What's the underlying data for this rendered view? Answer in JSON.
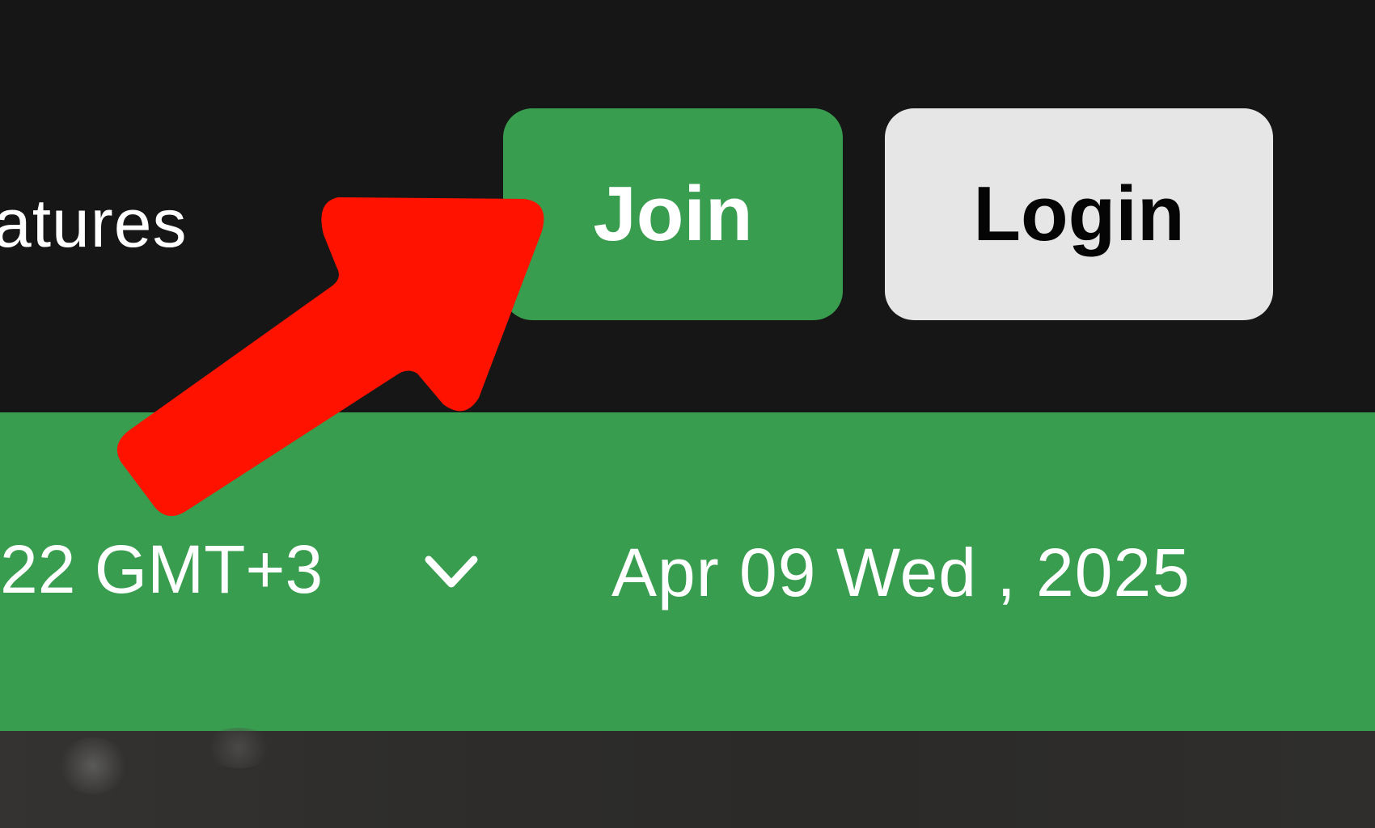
{
  "nav": {
    "features_label": "atures",
    "join_label": "Join",
    "login_label": "Login"
  },
  "info_bar": {
    "timezone_text": "22 GMT+3",
    "date_text": "Apr 09 Wed , 2025"
  },
  "colors": {
    "background": "#161616",
    "accent_green": "#389d4e",
    "login_bg": "#e6e6e6",
    "annotation_arrow": "#ff1300"
  },
  "icons": {
    "timezone_dropdown": "chevron-down-icon",
    "annotation": "arrow-pointer-icon"
  }
}
